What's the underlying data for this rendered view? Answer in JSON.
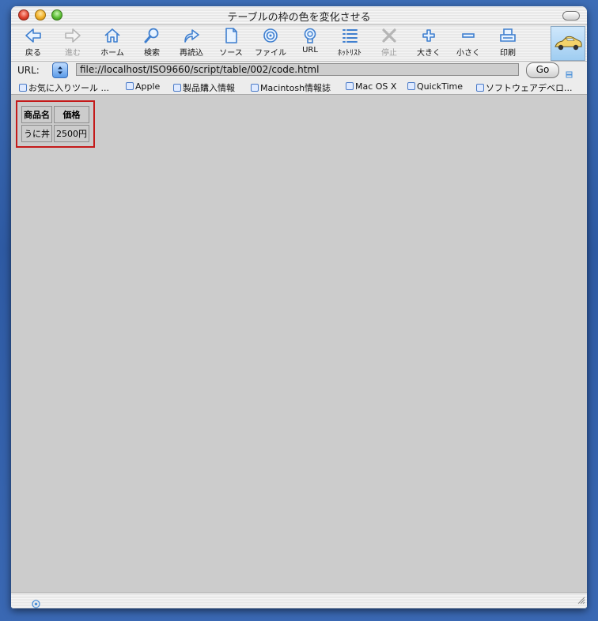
{
  "window": {
    "title": "テーブルの枠の色を変化させる"
  },
  "toolbar": {
    "buttons": [
      {
        "label": "戻る",
        "icon": "back-arrow-icon"
      },
      {
        "label": "進む",
        "icon": "forward-arrow-icon"
      },
      {
        "label": "ホーム",
        "icon": "home-icon"
      },
      {
        "label": "検索",
        "icon": "search-icon"
      },
      {
        "label": "再読込",
        "icon": "reload-icon"
      },
      {
        "label": "ソース",
        "icon": "source-icon"
      },
      {
        "label": "ファイル",
        "icon": "file-icon"
      },
      {
        "label": "URL",
        "icon": "url-icon"
      },
      {
        "label": "ﾎｯﾄﾘｽﾄ",
        "icon": "hotlist-icon"
      },
      {
        "label": "停止",
        "icon": "stop-icon"
      },
      {
        "label": "大きく",
        "icon": "plus-icon"
      },
      {
        "label": "小さく",
        "icon": "minus-icon"
      },
      {
        "label": "印刷",
        "icon": "print-icon"
      }
    ]
  },
  "urlbar": {
    "label": "URL:",
    "value": "file://localhost/ISO9660/script/table/002/code.html",
    "go_label": "Go"
  },
  "favorites": {
    "items": [
      {
        "label": "お気に入りツール ..."
      },
      {
        "label": "Apple"
      },
      {
        "label": "製品購入情報"
      },
      {
        "label": "Macintosh情報誌"
      },
      {
        "label": "Mac OS X"
      },
      {
        "label": "QuickTime"
      },
      {
        "label": "ソフトウェアデベロ..."
      }
    ]
  },
  "page": {
    "table": {
      "headers": [
        "商品名",
        "価格"
      ],
      "rows": [
        [
          "うに丼",
          "2500円"
        ]
      ],
      "border_color": "#c41a1a"
    }
  },
  "colors": {
    "desktop": "#3a68b3",
    "content_bg": "#cccccc",
    "accent_blue": "#4a90d9"
  }
}
